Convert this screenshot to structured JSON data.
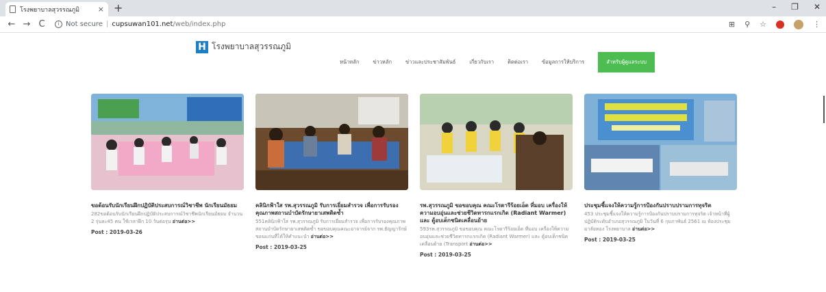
{
  "browser": {
    "tab_title": "โรงพยาบาลสุวรรณภูมิ",
    "tab_close": "×",
    "new_tab": "+",
    "window_controls": [
      "–",
      "❐",
      "✕"
    ],
    "nav_buttons": [
      "←",
      "→",
      "C"
    ],
    "security_label": "Not secure",
    "url_host": "cupsuwan101.net",
    "url_path": "/web/index.php",
    "toolbar_icons": [
      "translate-icon",
      "zoom-icon",
      "star-icon",
      "extension-icon",
      "profile-icon",
      "menu-icon"
    ],
    "toolbar_glyphs": [
      "⊞",
      "⚲",
      "☆",
      "⋮"
    ]
  },
  "site": {
    "logo_letter": "H",
    "logo_text": "โรงพยาบาลสุวรรณภูมิ",
    "nav": [
      "หน้าหลัก",
      "ข่าวหลัก",
      "ข่าวและประชาสัมพันธ์",
      "เกี่ยวกับเรา",
      "ติดต่อเรา",
      "ข้อมูลการให้บริการ"
    ],
    "nav_cta": "สำหรับผู้ดูแลระบบ",
    "accent_color": "#4dbd52"
  },
  "articles": [
    {
      "title": "ขอต้อนรับนักเรียนฝึกปฏิบัติประสบการณ์วิชาชีพ นักเรียนมัธยม",
      "excerpt": "282ขอต้อนรับนักเรียนฝึกปฏิบัติประสบการณ์วิชาชีพนักเรียนมัธยม จำนวน 2 รุ่นละ45 คน ใช้เวลาฝึก 10 วันต่อรุ่น ",
      "read_more": "อ่านต่อ>>",
      "date": "Post : 2019-03-26"
    },
    {
      "title": "คลินิกฟ้าใส รพ.สุวรรณภูมิ รับการเยี่ยมสำรวจ เพื่อการรับรองคุณภาพสถานบำบัดรักษายาเสพติดซ้ำ",
      "excerpt": "551คลินิกฟ้าใส รพ.สุวรรณภูมิ รับการเยี่ยมสำรวจ เพื่อการรับรองคุณภาพสถานบำบัดรักษายาเสพติดซ้ำ ขอขอบคุณคณะอาจารย์จาก รพ.ธัญญารักษ์ ขอนแก่นที่ได้ให้คำแนะนำ ",
      "read_more": "อ่านต่อ>>",
      "date": "Post : 2019-03-25"
    },
    {
      "title": "รพ.สุวรรณภูมิ ขอขอบคุณ คณะโรตารีร้อยเอ็ด ที่มอบ เครื่องให้ความอบอุ่นและช่วยชีวิตทารกแรกเกิด (Radiant Warmer) และ ตู้อบเด็กชนิดเคลื่อนย้าย",
      "excerpt": "593รพ.สุวรรณภูมิ ขอขอบคุณ คณะโรตารีร้อยเอ็ด ที่มอบ เครื่องให้ความอบอุ่นและช่วยชีวิตทารกแรกเกิด (Radiant Warmer) และ ตู้อบเด็กชนิดเคลื่อนย้าย (Transport ",
      "read_more": "อ่านต่อ>>",
      "date": "Post : 2019-03-25"
    },
    {
      "title": "ประชุมชี้แจงให้ความรู้การป้องกันปราบปรามการทุจริต",
      "excerpt": "453 ประชุมชี้แจงให้ความรู้การป้องกันปราบปรามการทุจริต เจ้าหน้าที่ผู้ปฏิบัติระดับอำเภอสุวรรณภูมิ ในวันที่ 6 กุมภาพันธ์ 2561 ณ ห้องประชุมมาลัยทอง โรงพยาบาล ",
      "read_more": "อ่านต่อ>>",
      "date": "Post : 2019-03-25"
    }
  ]
}
